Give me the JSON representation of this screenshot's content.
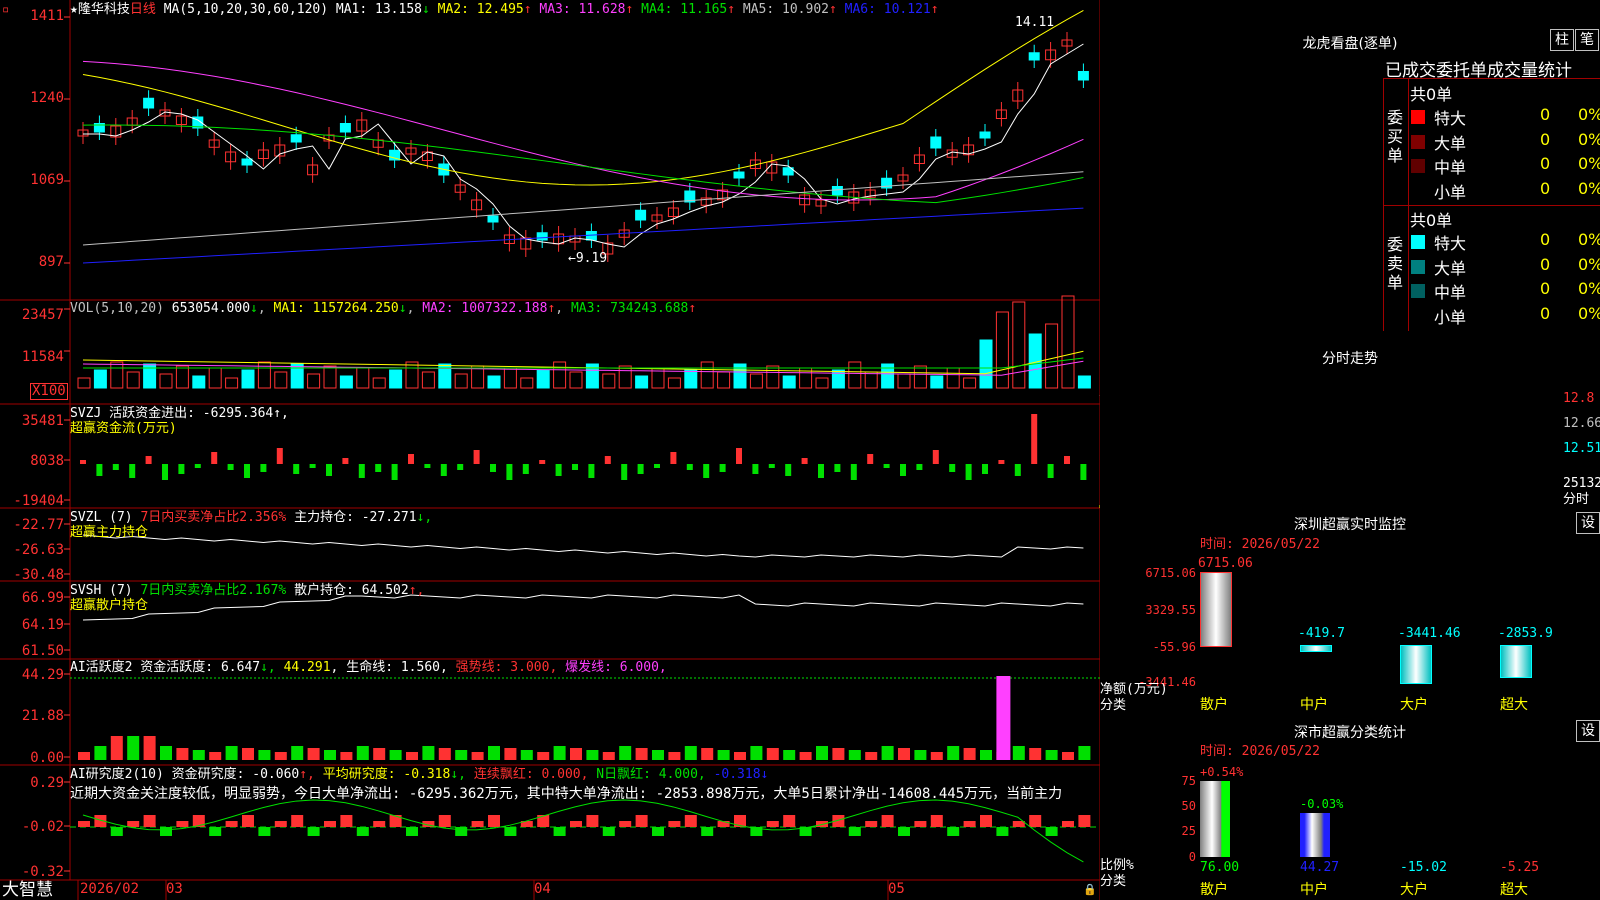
{
  "stock": {
    "star": "★",
    "name": "隆华科技",
    "period": "日线"
  },
  "main_chart": {
    "ma_label": "MA(5,10,20,30,60,120)",
    "ma": [
      {
        "label": "MA1: 13.158",
        "arrow": "↓",
        "color": "#ffffff"
      },
      {
        "label": "MA2: 12.495",
        "arrow": "↑",
        "color": "#ffff00"
      },
      {
        "label": "MA3: 11.628",
        "arrow": "↑",
        "color": "#ff40ff"
      },
      {
        "label": "MA4: 11.165",
        "arrow": "↑",
        "color": "#00e000"
      },
      {
        "label": "MA5: 10.902",
        "arrow": "↑",
        "color": "#c0c0c0"
      },
      {
        "label": "MA6: 10.121",
        "arrow": "↑",
        "color": "#2020ff"
      }
    ],
    "y_ticks": [
      "1411",
      "1240",
      "1069",
      "897"
    ],
    "high_label": "14.11",
    "low_label": "9.19"
  },
  "vol": {
    "title": "VOL(5,10,20)",
    "value": "653054.000",
    "value_arrow": "↓",
    "ma1": "MA1: 1157264.250",
    "ma1_arrow": "↓",
    "ma2": "MA2: 1007322.188",
    "ma2_arrow": "↑",
    "ma3": "MA3: 734243.688",
    "ma3_arrow": "↑",
    "y_ticks": [
      "23457",
      "11584"
    ],
    "unit": "X100"
  },
  "svzj": {
    "title": "SVZJ  活跃资金进出: -6295.364",
    "arrow": "↑,",
    "subtitle": "超赢资金流(万元)",
    "y_ticks": [
      "35481",
      "8038",
      "-19404"
    ]
  },
  "svzl": {
    "title": "SVZL (7)",
    "net": "7日内买卖净占比2.356%",
    "hold": "主力持仓: -27.271",
    "arrow": "↓,",
    "subtitle": "超赢主力持仓",
    "y_ticks": [
      "-22.77",
      "-26.63",
      "-30.48"
    ]
  },
  "svsh": {
    "title": "SVSH (7)",
    "net": "7日内买卖净占比2.167%",
    "hold": "散户持仓: 64.502",
    "arrow": "↑,",
    "subtitle": "超赢散户持仓",
    "y_ticks": [
      "66.99",
      "64.19",
      "61.50"
    ]
  },
  "ai_active": {
    "title": "AI活跃度2 资金活跃度: 6.647",
    "a1": "↓,",
    "v2": "44.291",
    "a2": ",",
    "life": "生命线: 1.560",
    "a3": ",",
    "strong": "强势线: 3.000",
    "a4": ",",
    "burst": "爆发线: 6.000",
    "a5": ",",
    "y_ticks": [
      "44.29",
      "21.88",
      "0.00"
    ]
  },
  "ai_research": {
    "title": "AI研究度2(10) 资金研究度: -0.060",
    "a1": "↑,",
    "avg": "平均研究度: -0.318",
    "a2": "↓,",
    "red1": "连续飘红: 0.000,",
    "red2": "N日飘红: 4.000,",
    "last": "-0.318",
    "a3": "↓",
    "comment": "近期大资金关注度较低，明显弱势，今日大单净流出: -6295.362万元，其中特大单净流出: -2853.898万元，大单5日累计净出-14608.445万元，当前主力",
    "y_ticks": [
      "0.29",
      "-0.02",
      "-0.32"
    ]
  },
  "footer": {
    "brand": "大智慧",
    "dates": [
      "2026/02",
      "03",
      "04",
      "05"
    ]
  },
  "dragon": {
    "title": "龙虎看盘(逐单)",
    "btn_bar": "柱",
    "btn_pen": "笔",
    "tabs": "已成交委托单成交量统计",
    "buy_side": "委买单",
    "sell_side": "委卖单",
    "buy_total": "共0单",
    "sell_total": "共0单",
    "buy_rows": [
      {
        "label": "特大",
        "count": "0",
        "pct": "0%",
        "color": "#ff0000"
      },
      {
        "label": "大单",
        "count": "0",
        "pct": "0%",
        "color": "#800000"
      },
      {
        "label": "中单",
        "count": "0",
        "pct": "0%",
        "color": "#600000"
      },
      {
        "label": "小单",
        "count": "0",
        "pct": "0%",
        "color": "#000000"
      }
    ],
    "sell_rows": [
      {
        "label": "特大",
        "count": "0",
        "pct": "0%",
        "color": "#00ffff"
      },
      {
        "label": "大单",
        "count": "0",
        "pct": "0%",
        "color": "#008080"
      },
      {
        "label": "中单",
        "count": "0",
        "pct": "0%",
        "color": "#006060"
      },
      {
        "label": "小单",
        "count": "0",
        "pct": "0%",
        "color": "#000000"
      }
    ]
  },
  "minute": {
    "title": "分时走势",
    "prices": [
      "12.8",
      "12.66",
      "12.51"
    ],
    "vol_label": "25132",
    "vol_unit": "分时"
  },
  "sz_monitor": {
    "title": "深圳超赢实时监控",
    "btn": "设",
    "time": "时间: 2026/05/22",
    "y_ticks": [
      "6715.06",
      "3329.55",
      "-55.96",
      "-3441.46"
    ],
    "ylabel1": "净额(万元)",
    "ylabel2": "分类",
    "bars": [
      {
        "cat": "散户",
        "value": 6715.06,
        "label": "6715.06",
        "color": "#ff3232"
      },
      {
        "cat": "中户",
        "value": -419.7,
        "label": "-419.7",
        "color": "#00ffff"
      },
      {
        "cat": "大户",
        "value": -3441.46,
        "label": "-3441.46",
        "color": "#00ffff"
      },
      {
        "cat": "超大",
        "value": -2853.9,
        "label": "-2853.9",
        "color": "#00ffff"
      }
    ]
  },
  "sz_class": {
    "title": "深市超赢分类统计",
    "btn": "设",
    "time": "时间: 2026/05/22",
    "y_ticks": [
      "75",
      "50",
      "25",
      "0"
    ],
    "ylabel1": "比例%",
    "ylabel2": "分类",
    "bars": [
      {
        "cat": "散户",
        "value": 76.0,
        "label": "76.00",
        "delta": "+0.54%",
        "delta_color": "#ff3232",
        "color": "#00ff00"
      },
      {
        "cat": "中户",
        "value": 44.27,
        "label": "44.27",
        "delta": "-0.03%",
        "delta_color": "#00ff00",
        "color": "#2020ff"
      },
      {
        "cat": "大户",
        "value": -15.02,
        "label": "-15.02",
        "delta": "",
        "delta_color": "#00ffff",
        "color": "#00ffff"
      },
      {
        "cat": "超大",
        "value": -5.25,
        "label": "-5.25",
        "delta": "",
        "delta_color": "#ff3232",
        "color": "#ff3232"
      }
    ]
  },
  "colors": {
    "up": "#ff3232",
    "down": "#00ffff",
    "frame": "#a00000",
    "bg": "#000000"
  }
}
